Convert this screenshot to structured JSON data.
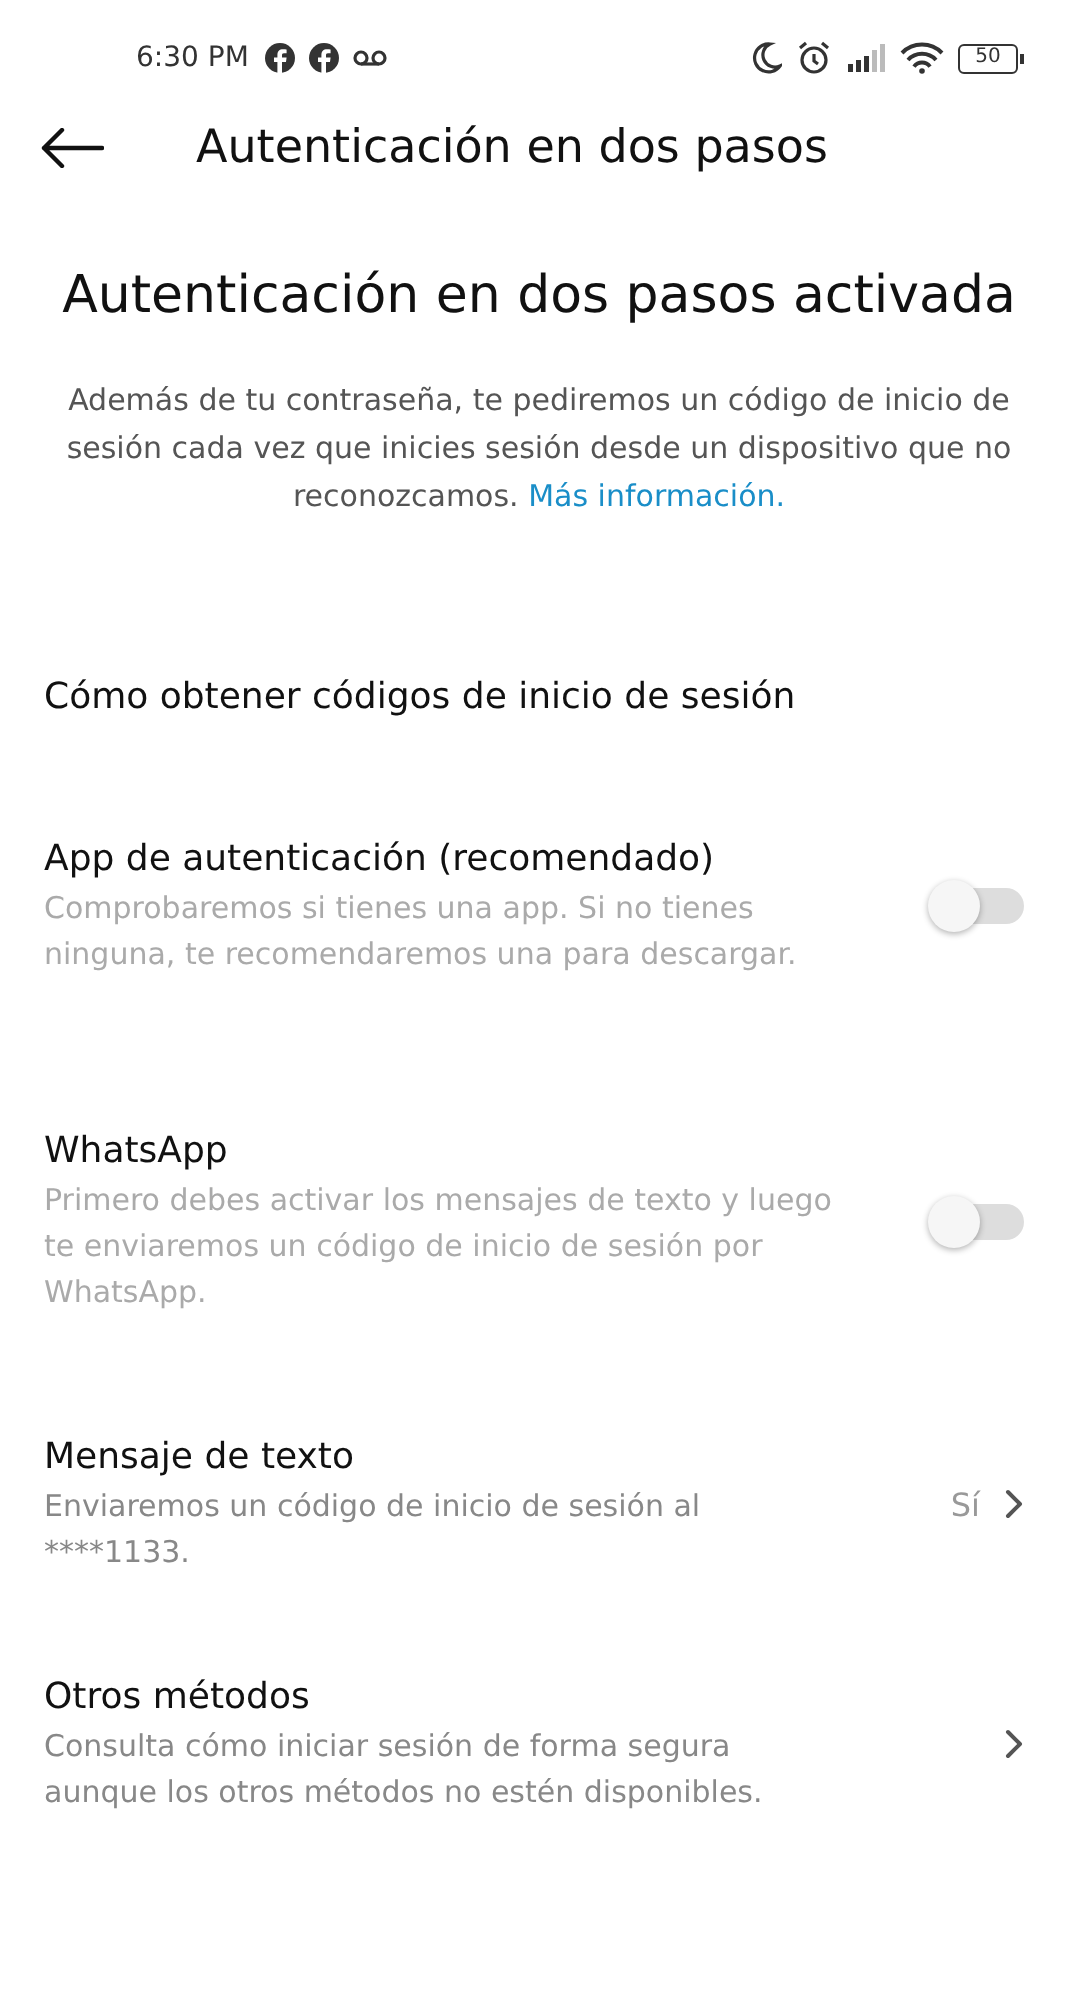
{
  "status_bar": {
    "time": "6:30 PM",
    "battery": "50"
  },
  "header": {
    "title": "Autenticación en dos pasos"
  },
  "hero": {
    "title": "Autenticación en dos pasos activada",
    "text": "Además de tu contraseña, te pediremos un código de inicio de sesión cada vez que inicies sesión desde un dispositivo que no reconozcamos.",
    "link": "Más información."
  },
  "section": {
    "label": "Cómo obtener códigos de inicio de sesión"
  },
  "methods": [
    {
      "kind": "toggle",
      "title": "App de autenticación (recomendado)",
      "description": "Comprobaremos si tienes una app. Si no tienes ninguna, te recomendaremos una para descargar.",
      "on": false
    },
    {
      "kind": "toggle",
      "title": "WhatsApp",
      "description": "Primero debes activar los mensajes de texto y luego te enviaremos un código de inicio de sesión por WhatsApp.",
      "on": false
    },
    {
      "kind": "link",
      "title": "Mensaje de texto",
      "description": "Enviaremos un código de inicio de sesión al ****1133.",
      "value": "Sí"
    },
    {
      "kind": "link",
      "title": "Otros métodos",
      "description": "Consulta cómo iniciar sesión de forma segura aunque los otros métodos no estén disponibles."
    }
  ]
}
